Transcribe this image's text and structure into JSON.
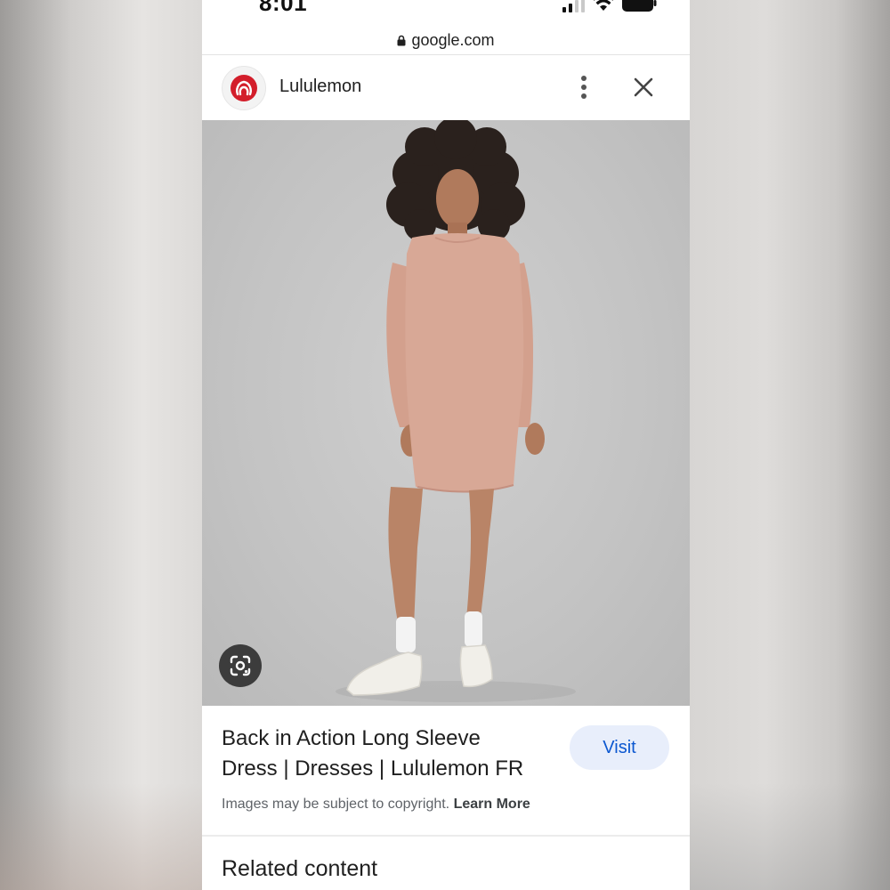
{
  "status_bar": {
    "time": "8:01"
  },
  "browser": {
    "url": "google.com"
  },
  "header": {
    "site_name": "Lululemon"
  },
  "result": {
    "title_line1": "Back in Action Long Sleeve",
    "title_line2": "Dress | Dresses | Lululemon FR",
    "visit_label": "Visit",
    "copyright_text": "Images may be subject to copyright.",
    "learn_more_label": "Learn More"
  },
  "related": {
    "heading": "Related content"
  },
  "icons": {
    "lock": "lock-icon",
    "logo": "lululemon-logo",
    "more": "more-vert-icon",
    "close": "close-icon",
    "lens": "google-lens-icon",
    "signal": "signal-icon",
    "wifi": "wifi-icon",
    "battery": "battery-icon"
  },
  "colors": {
    "brand_red": "#d31e2b",
    "visit_bg": "#e8eefb",
    "visit_text": "#0b57d0",
    "dress": "#d8a896",
    "photo_bg": "#c6c6c6"
  }
}
